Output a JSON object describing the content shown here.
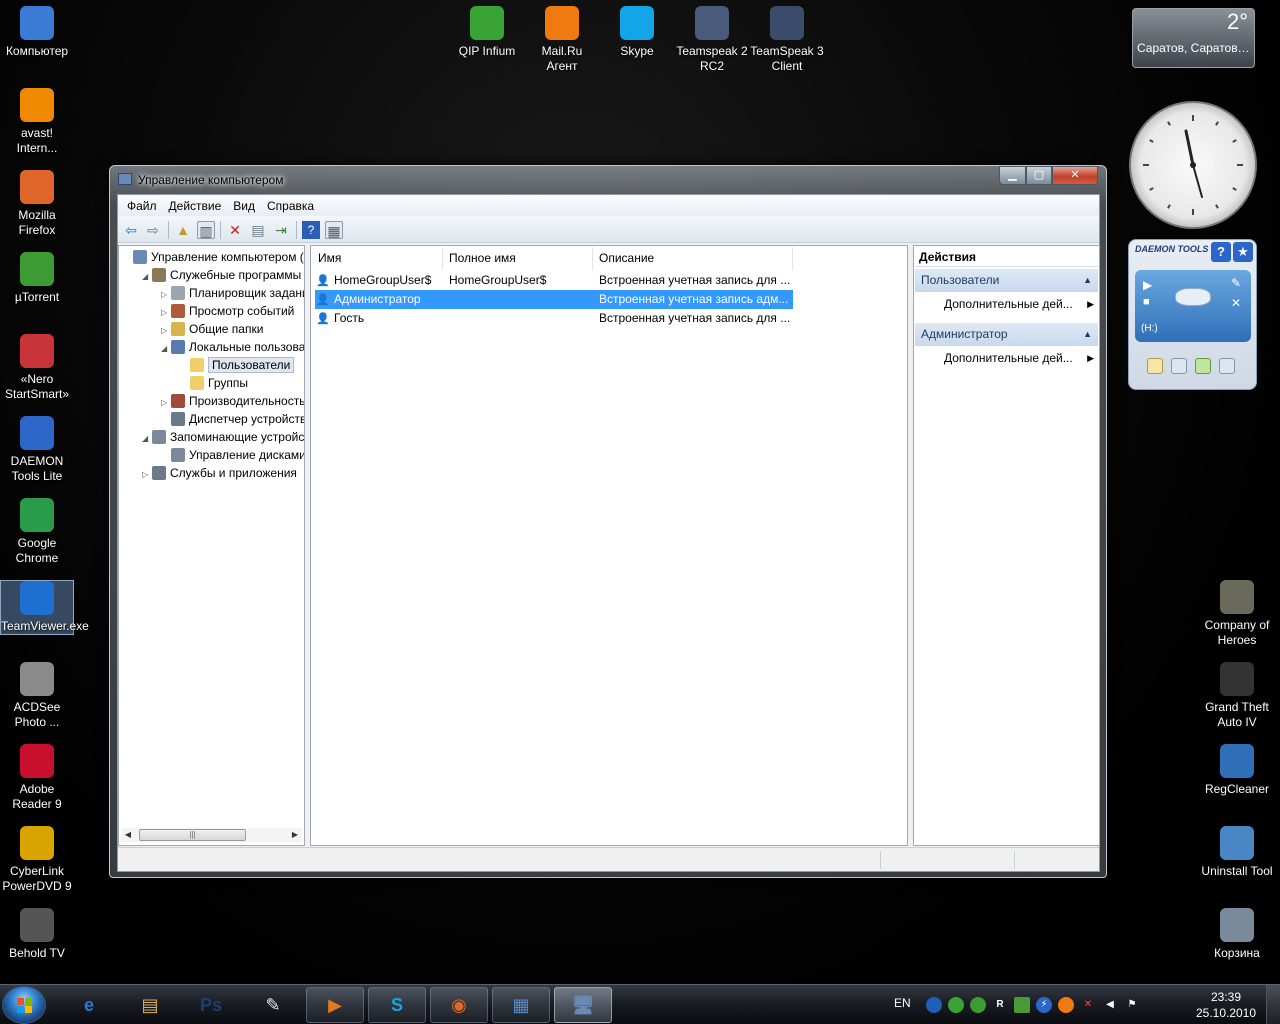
{
  "desktop": {
    "left_icons": [
      {
        "label": "Компьютер",
        "icon": "computer-icon",
        "color": "#3a7bd5"
      },
      {
        "label": "avast! Intern...",
        "icon": "avast-icon",
        "color": "#f08a00"
      },
      {
        "label": "Mozilla Firefox",
        "icon": "firefox-icon",
        "color": "#e0662a"
      },
      {
        "label": "µTorrent",
        "icon": "utorrent-icon",
        "color": "#3c9b32"
      },
      {
        "label": "«Nero StartSmart»",
        "icon": "nero-icon",
        "color": "#c8343a"
      },
      {
        "label": "DAEMON Tools Lite",
        "icon": "daemon-tools-icon",
        "color": "#2b66c8"
      },
      {
        "label": "Google Chrome",
        "icon": "chrome-icon",
        "color": "#2a9b4a"
      },
      {
        "label": "TeamViewer.exe",
        "icon": "teamviewer-icon",
        "color": "#1f6fd0"
      },
      {
        "label": "ACDSee Photo ...",
        "icon": "acdsee-icon",
        "color": "#8a8a8a"
      },
      {
        "label": "Adobe Reader 9",
        "icon": "adobe-reader-icon",
        "color": "#c8102e"
      },
      {
        "label": "CyberLink PowerDVD 9",
        "icon": "powerdvd-icon",
        "color": "#d9a400"
      },
      {
        "label": "Behold TV",
        "icon": "behold-tv-icon",
        "color": "#555555"
      }
    ],
    "top_icons": [
      {
        "label": "QIP Infium",
        "icon": "qip-icon",
        "color": "#3aa335"
      },
      {
        "label": "Mail.Ru Агент",
        "icon": "mailru-agent-icon",
        "color": "#f07a10"
      },
      {
        "label": "Skype",
        "icon": "skype-icon",
        "color": "#12a5e8"
      },
      {
        "label": "Teamspeak 2 RC2",
        "icon": "teamspeak2-icon",
        "color": "#4a5a7a"
      },
      {
        "label": "TeamSpeak 3 Client",
        "icon": "teamspeak3-icon",
        "color": "#3b4c6a"
      }
    ],
    "right_icons": [
      {
        "label": "Company of Heroes",
        "icon": "company-of-heroes-icon",
        "color": "#6a6a5a"
      },
      {
        "label": "Grand Theft Auto IV",
        "icon": "gta4-icon",
        "color": "#333333"
      },
      {
        "label": "RegCleaner",
        "icon": "regcleaner-icon",
        "color": "#2e6fb8"
      },
      {
        "label": "Uninstall Tool",
        "icon": "uninstall-tool-icon",
        "color": "#4a86c5"
      },
      {
        "label": "Корзина",
        "icon": "recycle-bin-icon",
        "color": "#7a8a9a"
      }
    ]
  },
  "gadgets": {
    "weather": {
      "temp": "2°",
      "city": "Саратов, Саратовс..."
    },
    "daemon": {
      "brand": "DAEMON TOOLS",
      "drive": "(H:)",
      "help": "?"
    }
  },
  "window": {
    "title": "Управление компьютером",
    "menu": [
      "Файл",
      "Действие",
      "Вид",
      "Справка"
    ],
    "tree": [
      {
        "label": "Управление компьютером (л",
        "level": 0,
        "exp": "",
        "icon_color": "#6a8ab5"
      },
      {
        "label": "Служебные программы",
        "level": 1,
        "exp": "◢",
        "icon_color": "#8a7a5a"
      },
      {
        "label": "Планировщик заданий",
        "level": 2,
        "exp": "▷",
        "icon_color": "#9aa5b0"
      },
      {
        "label": "Просмотр событий",
        "level": 2,
        "exp": "▷",
        "icon_color": "#b05a3a"
      },
      {
        "label": "Общие папки",
        "level": 2,
        "exp": "▷",
        "icon_color": "#d9b44a"
      },
      {
        "label": "Локальные пользовате",
        "level": 2,
        "exp": "◢",
        "icon_color": "#5a7ab0"
      },
      {
        "label": "Пользователи",
        "level": 3,
        "exp": "",
        "icon_color": "#f0cf6a",
        "selected": true
      },
      {
        "label": "Группы",
        "level": 3,
        "exp": "",
        "icon_color": "#f0cf6a"
      },
      {
        "label": "Производительность",
        "level": 2,
        "exp": "▷",
        "icon_color": "#a04a3a"
      },
      {
        "label": "Диспетчер устройств",
        "level": 2,
        "exp": "",
        "icon_color": "#6a7a8a"
      },
      {
        "label": "Запоминающие устройст",
        "level": 1,
        "exp": "◢",
        "icon_color": "#7a8a9a"
      },
      {
        "label": "Управление дисками",
        "level": 2,
        "exp": "",
        "icon_color": "#7a8a9a"
      },
      {
        "label": "Службы и приложения",
        "level": 1,
        "exp": "▷",
        "icon_color": "#6a7a8a"
      }
    ],
    "list": {
      "columns": [
        "Имя",
        "Полное имя",
        "Описание"
      ],
      "rows": [
        {
          "name": "HomeGroupUser$",
          "full_name": "HomeGroupUser$",
          "description": "Встроенная учетная запись для ..."
        },
        {
          "name": "Администратор",
          "full_name": "",
          "description": "Встроенная учетная запись адм...",
          "selected": true
        },
        {
          "name": "Гость",
          "full_name": "",
          "description": "Встроенная учетная запись для ..."
        }
      ]
    },
    "actions": {
      "title": "Действия",
      "sections": [
        {
          "label": "Пользователи",
          "item": "Дополнительные дей..."
        },
        {
          "label": "Администратор",
          "item": "Дополнительные дей..."
        }
      ]
    }
  },
  "taskbar": {
    "buttons": [
      {
        "name": "taskbar-ie",
        "glyph": "e",
        "color": "#1e7fd6",
        "state": "pinned"
      },
      {
        "name": "taskbar-explorer",
        "glyph": "▤",
        "color": "#d9b44a",
        "state": "pinned"
      },
      {
        "name": "taskbar-photoshop",
        "glyph": "Ps",
        "color": "#1d3f73",
        "state": "pinned"
      },
      {
        "name": "taskbar-notepad",
        "glyph": "✎",
        "color": "#e8e8e8",
        "state": "pinned"
      },
      {
        "name": "taskbar-media-player",
        "glyph": "▶",
        "color": "#e07a20",
        "state": "open"
      },
      {
        "name": "taskbar-skype",
        "glyph": "S",
        "color": "#12a5e8",
        "state": "open"
      },
      {
        "name": "taskbar-firefox",
        "glyph": "◉",
        "color": "#e0662a",
        "state": "open"
      },
      {
        "name": "taskbar-control-panel",
        "glyph": "▦",
        "color": "#5a8ac8",
        "state": "open"
      },
      {
        "name": "taskbar-computer-management",
        "glyph": "🖥",
        "color": "#6a8ab5",
        "state": "active"
      }
    ],
    "lang": "EN",
    "time": "23:39",
    "date": "25.10.2010"
  }
}
